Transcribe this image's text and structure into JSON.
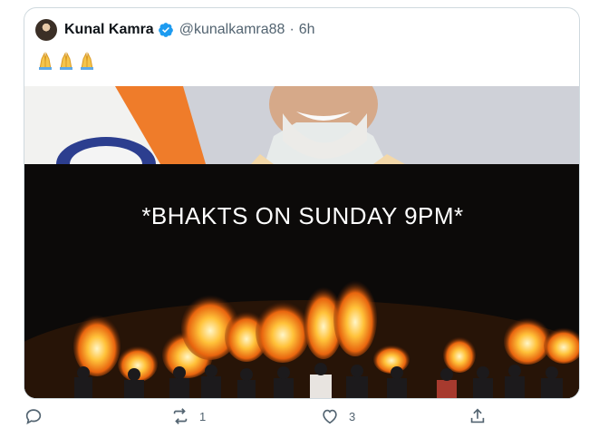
{
  "tweet": {
    "author_name": "Kunal Kamra",
    "handle": "@kunalkamra88",
    "separator": "·",
    "time": "6h",
    "text_emojis": [
      "folded-hands",
      "folded-hands",
      "folded-hands"
    ]
  },
  "media": {
    "caption": "*BHAKTS ON SUNDAY 9PM*"
  },
  "actions": {
    "reply_count": "",
    "retweet_count": "1",
    "like_count": "3"
  },
  "colors": {
    "verified": "#1d9bf0",
    "muted": "#536471",
    "border": "#cfd9de"
  }
}
